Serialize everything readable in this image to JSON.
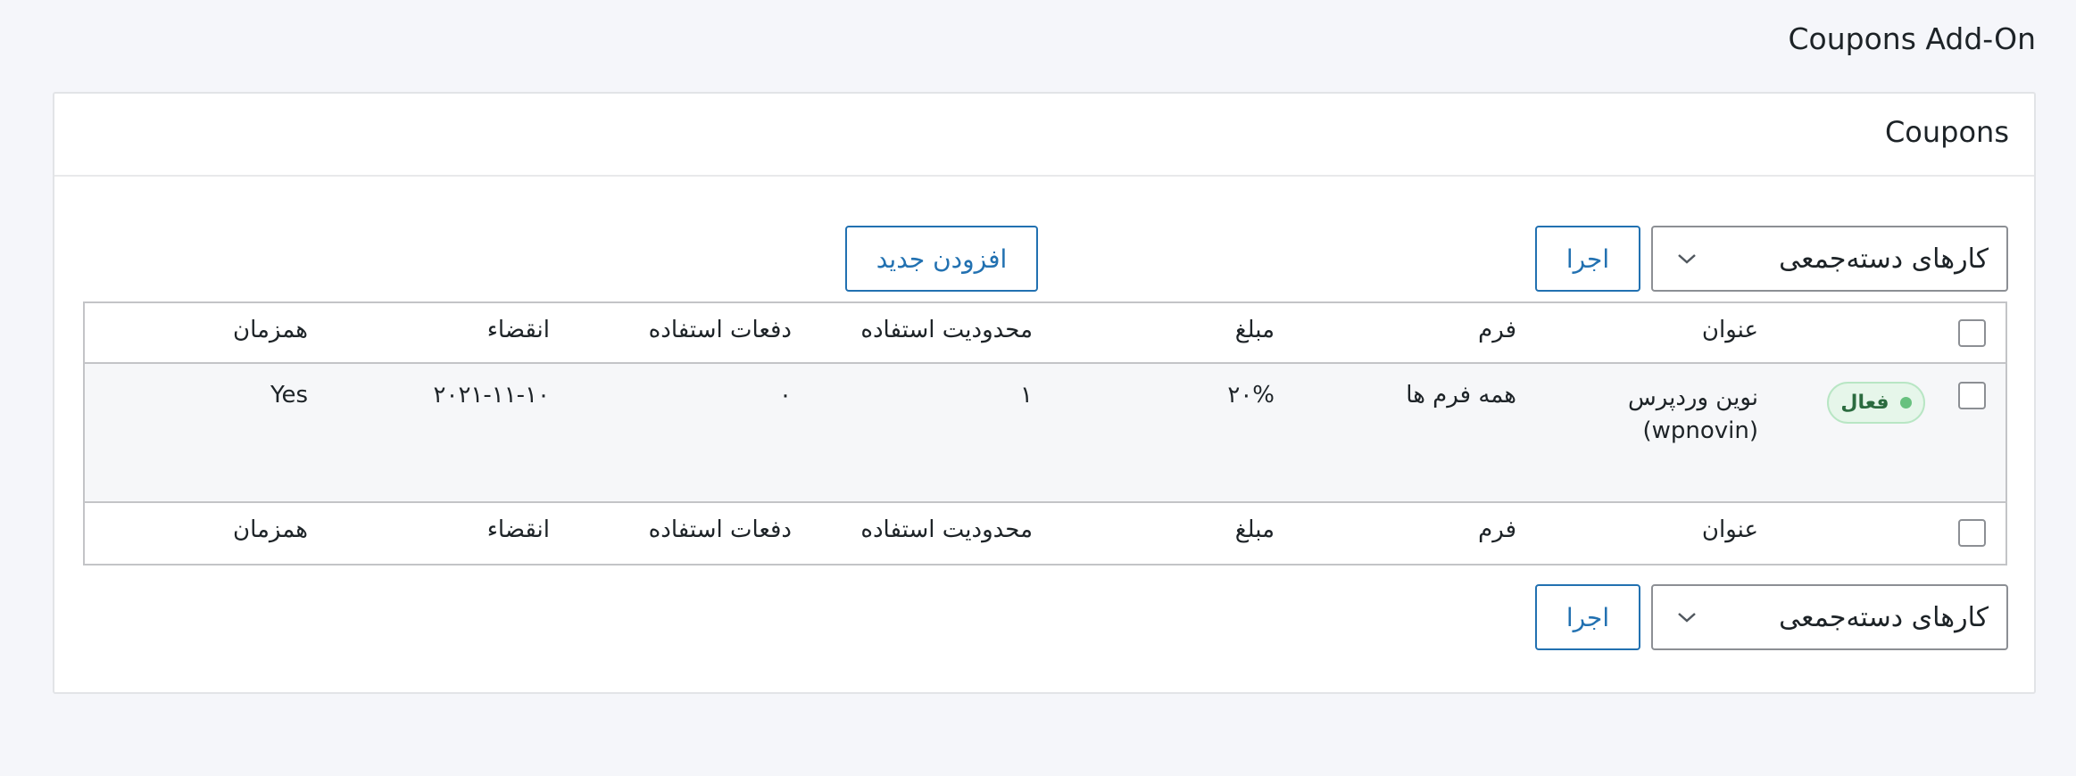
{
  "page": {
    "title": "Coupons Add-On"
  },
  "card": {
    "title": "Coupons"
  },
  "toolbar": {
    "bulk_actions_label": "کارهای دسته‌جمعی",
    "apply_label": "اجرا",
    "add_new_label": "افزودن جدید"
  },
  "table": {
    "columns": {
      "title": "عنوان",
      "form": "فرم",
      "amount": "مبلغ",
      "usage_limit": "محدودیت استفاده",
      "usage_count": "دفعات استفاده",
      "expiry": "انقضاء",
      "concurrent": "همزمان"
    },
    "rows": [
      {
        "status": "فعال",
        "title_line1": "نوین وردپرس",
        "title_line2": "(wpnovin)",
        "form": "همه فرم ها",
        "amount": "۲۰%",
        "usage_limit": "۱",
        "usage_count": "۰",
        "expiry": "۲۰۲۱-۱۱-۱۰",
        "concurrent": "Yes"
      }
    ]
  },
  "colors": {
    "accent": "#2271b1",
    "status_active_bg": "#e6f6ea",
    "status_active_dot": "#68c17f"
  },
  "icons": {
    "select_arrow": "chevron-down-icon"
  }
}
